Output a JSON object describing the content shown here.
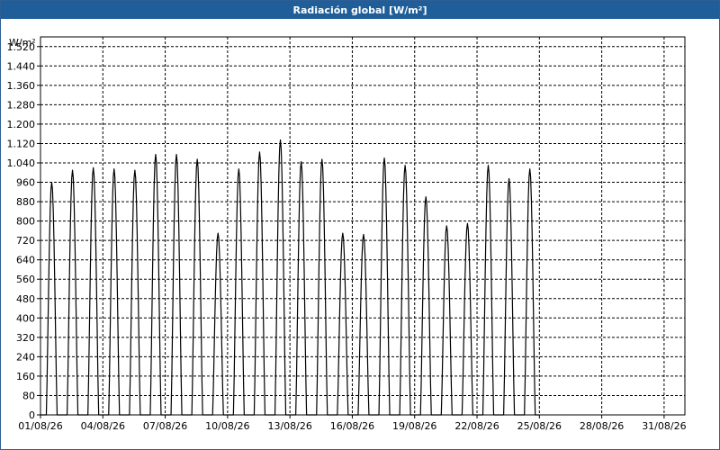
{
  "window": {
    "title": "Radiación global [W/m²]"
  },
  "chart_data": {
    "type": "line",
    "title": "Radiación global [W/m²]",
    "ylabel": "W/m²",
    "xlabel": "",
    "ylim": [
      0,
      1560
    ],
    "xlim": [
      "01/08/26",
      "01/09/26"
    ],
    "grid": true,
    "y_ticks": [
      "0",
      "80",
      "160",
      "240",
      "320",
      "400",
      "480",
      "560",
      "640",
      "720",
      "800",
      "880",
      "960",
      "1.040",
      "1.120",
      "1.200",
      "1.280",
      "1.360",
      "1.440",
      "1.520"
    ],
    "x_ticks": [
      "01/08/26",
      "04/08/26",
      "07/08/26",
      "10/08/26",
      "13/08/26",
      "16/08/26",
      "19/08/26",
      "22/08/26",
      "25/08/26",
      "28/08/26",
      "31/08/26"
    ],
    "series": [
      {
        "color": "#000000",
        "x": [
          "01/08/26",
          "02/08/26",
          "03/08/26",
          "04/08/26",
          "05/08/26",
          "06/08/26",
          "07/08/26",
          "08/08/26",
          "09/08/26",
          "10/08/26",
          "11/08/26",
          "12/08/26",
          "13/08/26",
          "14/08/26",
          "15/08/26",
          "16/08/26",
          "17/08/26",
          "18/08/26",
          "19/08/26",
          "20/08/26",
          "21/08/26",
          "22/08/26",
          "23/08/26",
          "24/08/26"
        ],
        "daily_peak": [
          960,
          1010,
          1020,
          1015,
          1010,
          1075,
          1075,
          1055,
          750,
          1015,
          1085,
          1135,
          1045,
          1055,
          750,
          745,
          1060,
          1030,
          900,
          780,
          790,
          1030,
          975,
          1015
        ]
      }
    ]
  }
}
